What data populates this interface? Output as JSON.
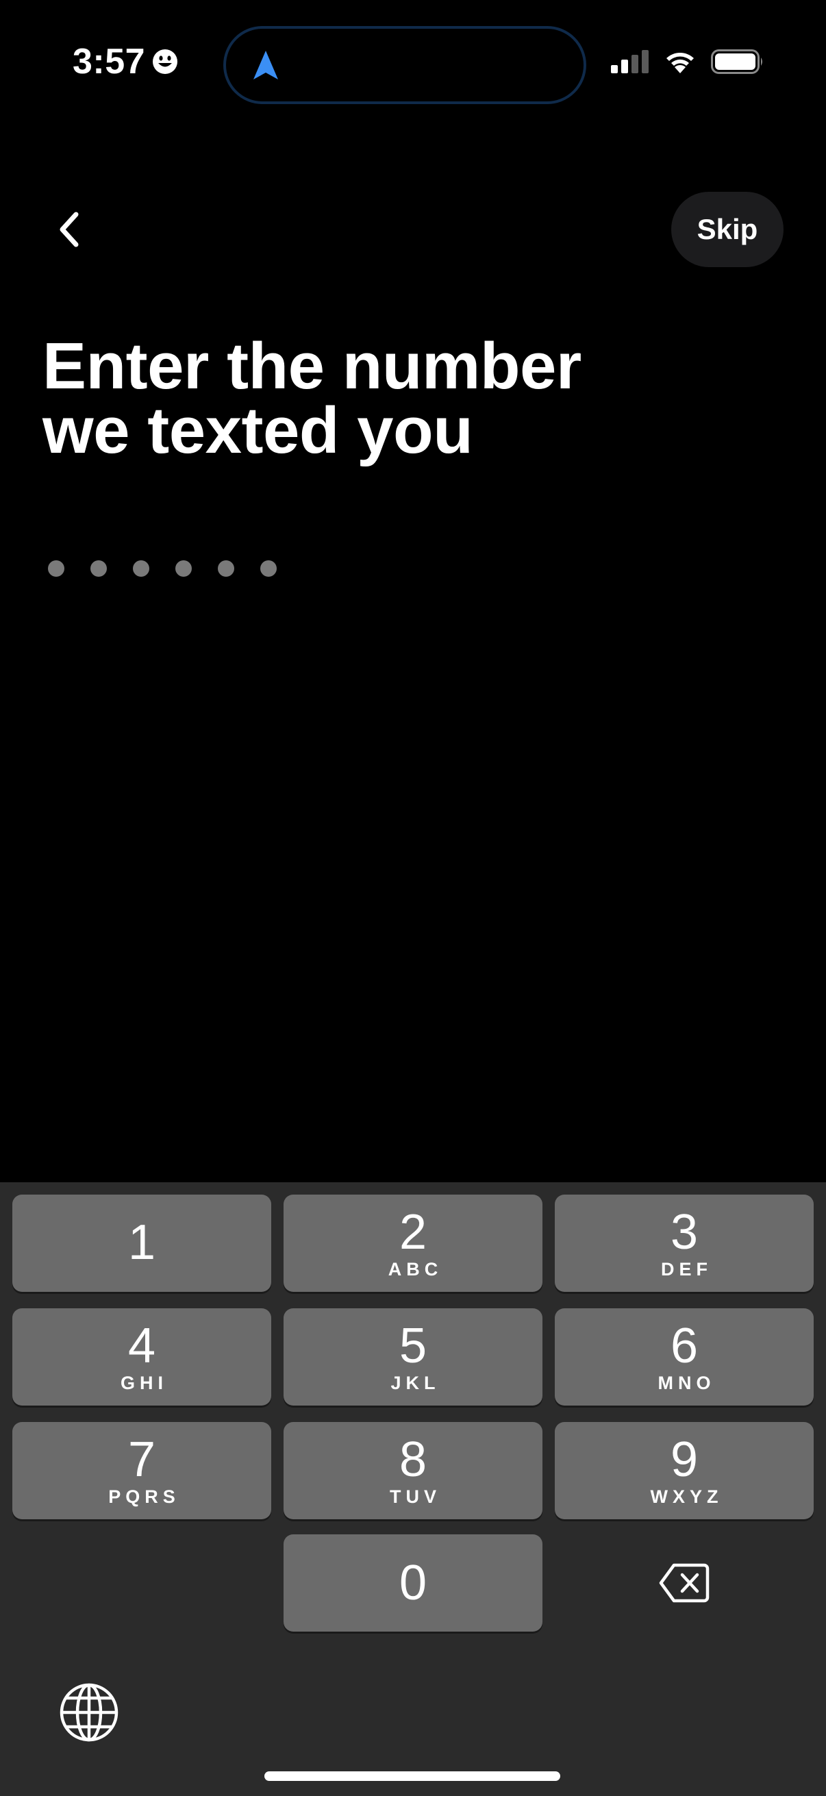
{
  "status_bar": {
    "time": "3:57",
    "icons": [
      "smiley-icon",
      "navigation-arrow-icon",
      "cellular-signal-icon",
      "wifi-icon",
      "battery-icon"
    ]
  },
  "header": {
    "back_icon": "chevron-left-icon",
    "skip_label": "Skip"
  },
  "title": {
    "line1": "Enter the number",
    "line2": "we texted you"
  },
  "code_input": {
    "length": 6,
    "filled": 0
  },
  "keypad": {
    "keys": [
      {
        "digit": "1",
        "letters": ""
      },
      {
        "digit": "2",
        "letters": "ABC"
      },
      {
        "digit": "3",
        "letters": "DEF"
      },
      {
        "digit": "4",
        "letters": "GHI"
      },
      {
        "digit": "5",
        "letters": "JKL"
      },
      {
        "digit": "6",
        "letters": "MNO"
      },
      {
        "digit": "7",
        "letters": "PQRS"
      },
      {
        "digit": "8",
        "letters": "TUV"
      },
      {
        "digit": "9",
        "letters": "WXYZ"
      },
      {
        "digit": "0",
        "letters": ""
      }
    ],
    "delete_icon": "backspace-icon",
    "globe_icon": "globe-icon"
  },
  "colors": {
    "background": "#000000",
    "keypad_background": "#2b2b2b",
    "key_background": "#6b6b6b",
    "skip_background": "#1c1c1e",
    "dot": "#7a7a7a",
    "navigation_arrow": "#3b8ff5"
  }
}
